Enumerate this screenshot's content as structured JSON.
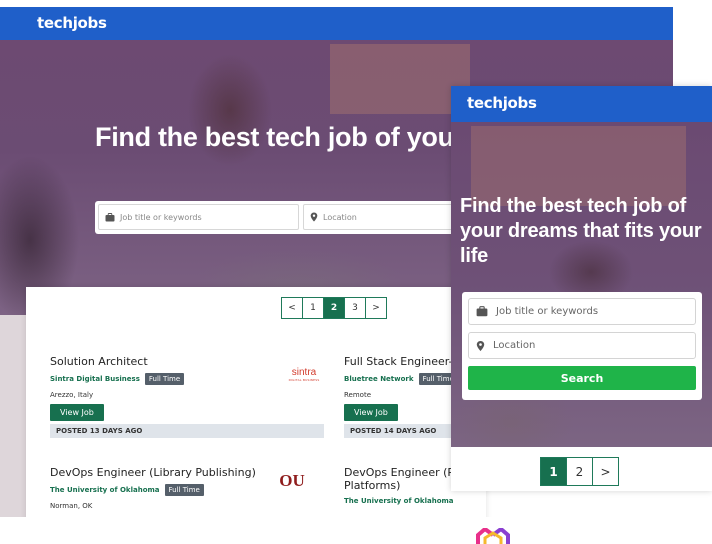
{
  "brand": "techjobs",
  "desktop": {
    "hero_title": "Find the best tech job of your dreams that fits your life",
    "search": {
      "keyword_placeholder": "Job title or keywords",
      "location_placeholder": "Location"
    },
    "pagination": [
      "<",
      "1",
      "2",
      "3",
      ">"
    ],
    "active_page": "2",
    "jobs": [
      {
        "title": "Solution Architect",
        "company": "Sintra Digital Business",
        "type": "Full Time",
        "location": "Arezzo, Italy",
        "action": "View Job",
        "posted": "POSTED 13 DAYS AGO",
        "logo_text": "sintra",
        "logo_sub": "DIGITAL BUSINESS"
      },
      {
        "title": "Full Stack Engineer-",
        "company": "Bluetree Network",
        "type": "Full Time",
        "location": "Remote",
        "action": "View Job",
        "posted": "POSTED 14 DAYS AGO"
      },
      {
        "title": "DevOps Engineer (Library Publishing)",
        "company": "The University of Oklahoma",
        "type": "Full Time",
        "location": "Norman, OK",
        "logo_text": "OU"
      },
      {
        "title": "DevOps Engineer (R",
        "title_line2": "Platforms)",
        "company": "The University of Oklahoma"
      }
    ]
  },
  "mobile": {
    "hero_title": "Find the best tech job of your dreams that fits your life",
    "search": {
      "keyword_placeholder": "Job title or keywords",
      "location_placeholder": "Location",
      "button": "Search"
    },
    "pagination": [
      "1",
      "2",
      ">"
    ],
    "active_page": "1"
  },
  "colors": {
    "header_blue": "#1f5fc9",
    "brand_green": "#17704f",
    "search_green": "#1fb449",
    "hero_purple": "#6d4a72"
  }
}
